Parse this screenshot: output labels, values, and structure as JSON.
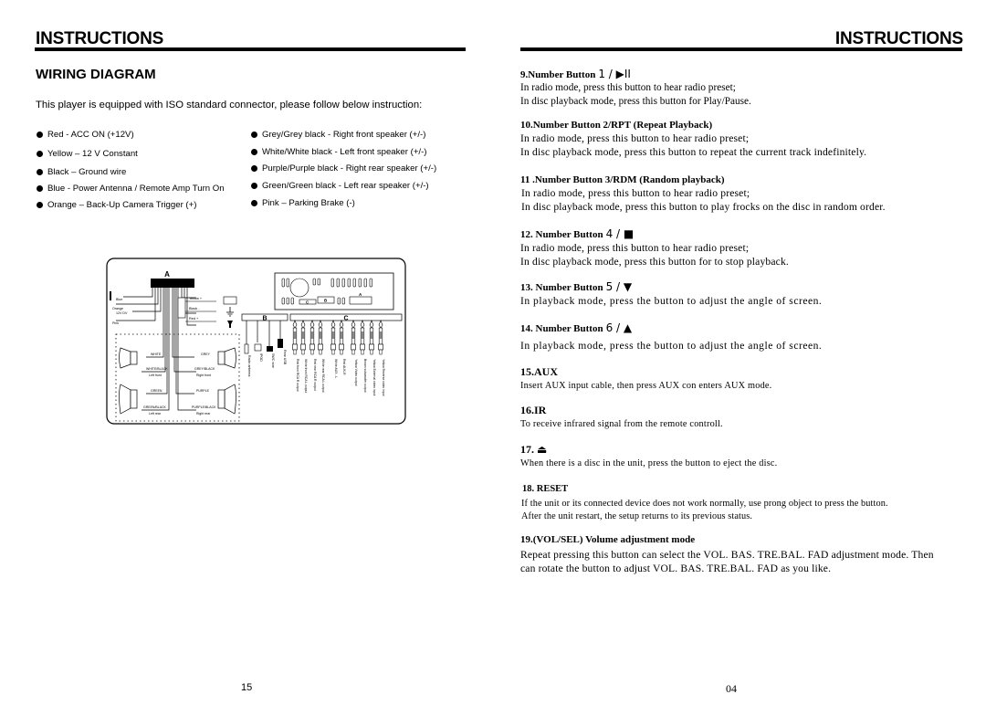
{
  "left_page": {
    "header": "INSTRUCTIONS",
    "section_title": "WIRING DIAGRAM",
    "intro": "This player is equipped with ISO standard connector, please follow below instruction:",
    "bullets_left": [
      "Red - ACC ON (+12V)",
      "Yellow – 12 V Constant",
      "Black – Ground wire",
      "Blue - Power Antenna / Remote Amp Turn On",
      "Orange – Back-Up Camera Trigger (+)"
    ],
    "bullets_right": [
      "Grey/Grey black - Right front speaker (+/-)",
      "White/White black - Left front speaker (+/-)",
      "Purple/Purple black - Right rear speaker (+/-)",
      "Green/Green black - Left rear speaker (+/-)",
      "Pink – Parking Brake (-)"
    ],
    "diagram": {
      "connector_labels": [
        "A",
        "B",
        "C"
      ],
      "head_unit_port_labels": [
        "C",
        "B",
        "A"
      ],
      "left_wires": [
        "Blue",
        "Orange",
        "12V DV",
        "Pink"
      ],
      "power_labels": [
        "Yellow +",
        "Black -",
        "Red +"
      ],
      "speakers": {
        "left_front": {
          "pos": "WHITE",
          "neg": "WHITE/BLACK",
          "label": "Left front"
        },
        "right_front": {
          "pos": "GREY",
          "neg": "GREY/BLACK",
          "label": "Right front"
        },
        "left_rear": {
          "pos": "GREEN",
          "neg": "GREEN/BLACK",
          "label": "Left rear"
        },
        "right_rear": {
          "pos": "PURPLE",
          "neg": "PURPLE/BLACK",
          "label": "Right rear"
        }
      },
      "b_connectors": [
        "Radio antenna",
        "IPOD",
        "SWC wire",
        "Rear USB"
      ],
      "c_connectors": [
        "Red front RCA R output",
        "White front RCA L output",
        "Red rear RCA R output",
        "White rear RCA L output",
        "White AUX - L",
        "Red AUX-R",
        "Yellow Video output",
        "Brown subwoofer output",
        "Yellow External video input",
        "Yellow Reverse video input"
      ]
    },
    "page_number": "15"
  },
  "right_page": {
    "header": "INSTRUCTIONS",
    "sections": [
      {
        "title": "9.Number Button",
        "glyph": "1 / ▶II",
        "lines": [
          "In radio mode, press this button to hear radio preset;",
          "In disc playback mode, press this button for Play/Pause."
        ]
      },
      {
        "title": "10.Number Button 2/RPT (Repeat Playback)",
        "lines": [
          "In radio mode, press this button to hear radio preset;",
          "In disc playback mode, press this button to repeat the current track indefinitely."
        ]
      },
      {
        "title": "11 .Number Button 3/RDM (Random playback)",
        "lines": [
          "In radio mode, press this button to hear radio preset;",
          "In disc playback mode, press this button to play frocks on the disc in random order."
        ]
      },
      {
        "title": "12. Number Button",
        "glyph": "4 / ■",
        "lines": [
          "In radio mode, press this button to hear radio preset;",
          "In disc playback mode, press this button for to stop playback."
        ]
      },
      {
        "title": "13. Number Button",
        "glyph": "5 / ▼",
        "lines": [
          "In playback mode, press the button to adjust the angle of screen."
        ]
      },
      {
        "title": "14. Number Button",
        "glyph": "6 / ▲",
        "lines": [
          "In playback mode, press the button to adjust the angle of screen."
        ]
      },
      {
        "title": "15.AUX",
        "lines": [
          "Insert AUX input cable, then press  AUX con enters AUX mode."
        ]
      },
      {
        "title": "16.IR",
        "lines": [
          "To receive infrared signal from the remote controll."
        ]
      },
      {
        "title": "17.",
        "glyph": "⏏",
        "lines": [
          "When there is a disc in the unit, press the button to eject the disc."
        ]
      },
      {
        "title": "18. RESET",
        "lines": [
          "If the unit or its connected device does not work normally, use prong object to press the button.",
          "After the unit restart, the setup returns to its previous status."
        ]
      },
      {
        "title": "19.(VOL/SEL) Volume adjustment mode",
        "lines": [
          "Repeat pressing this button can select the VOL. BAS. TRE.BAL. FAD adjustment mode. Then",
          "can rotate the button to adjust VOL. BAS. TRE.BAL. FAD as you like."
        ]
      }
    ],
    "page_number": "04"
  }
}
